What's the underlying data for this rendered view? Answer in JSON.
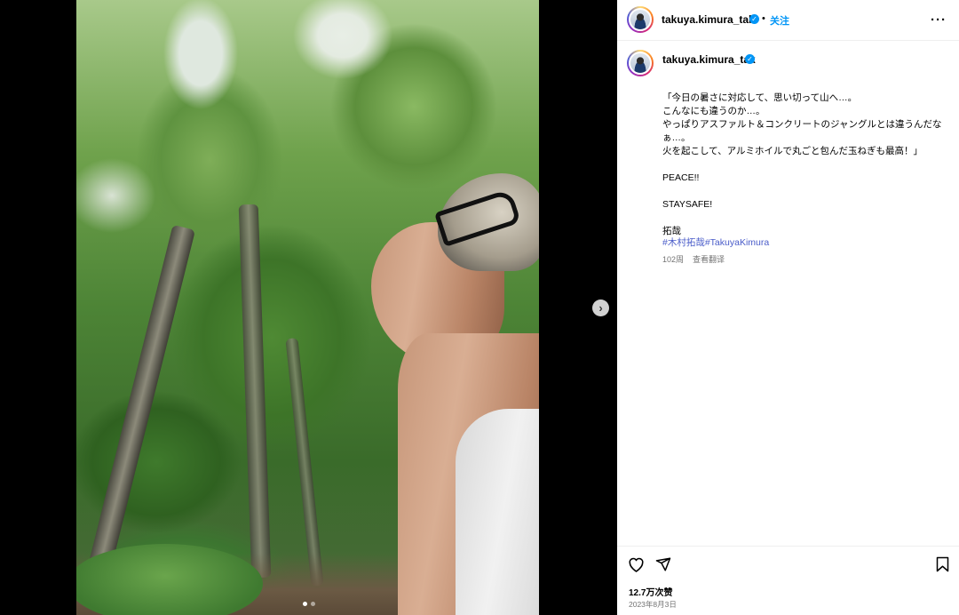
{
  "post": {
    "media": {
      "next_icon": "chevron-right-icon",
      "carousel_count": 2,
      "carousel_active": 1
    },
    "header": {
      "username": "takuya.kimura_tak",
      "separator": "•",
      "follow_label": "关注",
      "more_icon": "more-horizontal-icon",
      "more_label": "···"
    },
    "caption": {
      "username": "takuya.kimura_tak",
      "text": "「今日の暑さに対応して、思い切って山へ…。\nこんなにも違うのか…。\nやっぱりアスファルト＆コンクリートのジャングルとは違うんだなぁ…。\n火を起こして、アルミホイルで丸ごと包んだ玉ねぎも最高！」\n\nPEACE!!\n\nSTAYSAFE!\n\n拓哉",
      "hashtags": [
        "#木村拓哉",
        "#TakuyaKimura"
      ],
      "age": "102周",
      "translate_label": "查看翻译"
    },
    "actions": {
      "like_icon": "heart-icon",
      "share_icon": "send-icon",
      "save_icon": "bookmark-icon"
    },
    "likes": "12.7万次赞",
    "date": "2023年8月3日"
  },
  "colors": {
    "link_blue": "#0095f6",
    "hashtag_blue": "#4a5cc9",
    "muted_gray": "#737373",
    "verified_blue": "#0095f6"
  }
}
